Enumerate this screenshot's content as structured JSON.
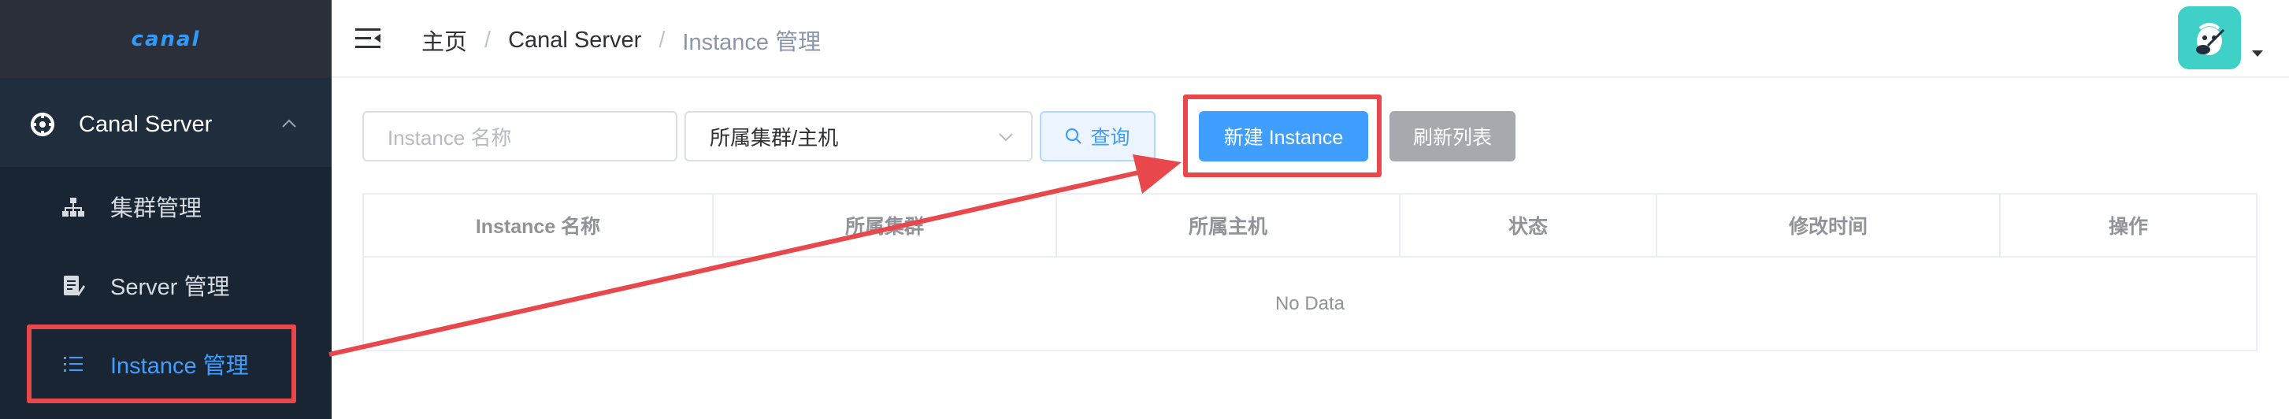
{
  "sidebar": {
    "logo": "canal",
    "parent": {
      "label": "Canal Server",
      "icon": "settings-icon"
    },
    "items": [
      {
        "label": "集群管理",
        "icon": "cluster-icon"
      },
      {
        "label": "Server 管理",
        "icon": "server-icon"
      },
      {
        "label": "Instance 管理",
        "icon": "list-icon",
        "active": true
      }
    ]
  },
  "header": {
    "breadcrumb": [
      "主页",
      "Canal Server",
      "Instance 管理"
    ],
    "separator": "/"
  },
  "toolbar": {
    "name_placeholder": "Instance 名称",
    "select_value": "所属集群/主机",
    "search_label": "查询",
    "new_label": "新建 Instance",
    "refresh_label": "刷新列表"
  },
  "table": {
    "columns": [
      "Instance 名称",
      "所属集群",
      "所属主机",
      "状态",
      "修改时间",
      "操作"
    ],
    "empty_text": "No Data"
  },
  "colors": {
    "sidebar_bg": "#1f2d3d",
    "accent": "#409eff",
    "highlight": "#e8484b",
    "avatar_bg": "#3fd1c8"
  }
}
